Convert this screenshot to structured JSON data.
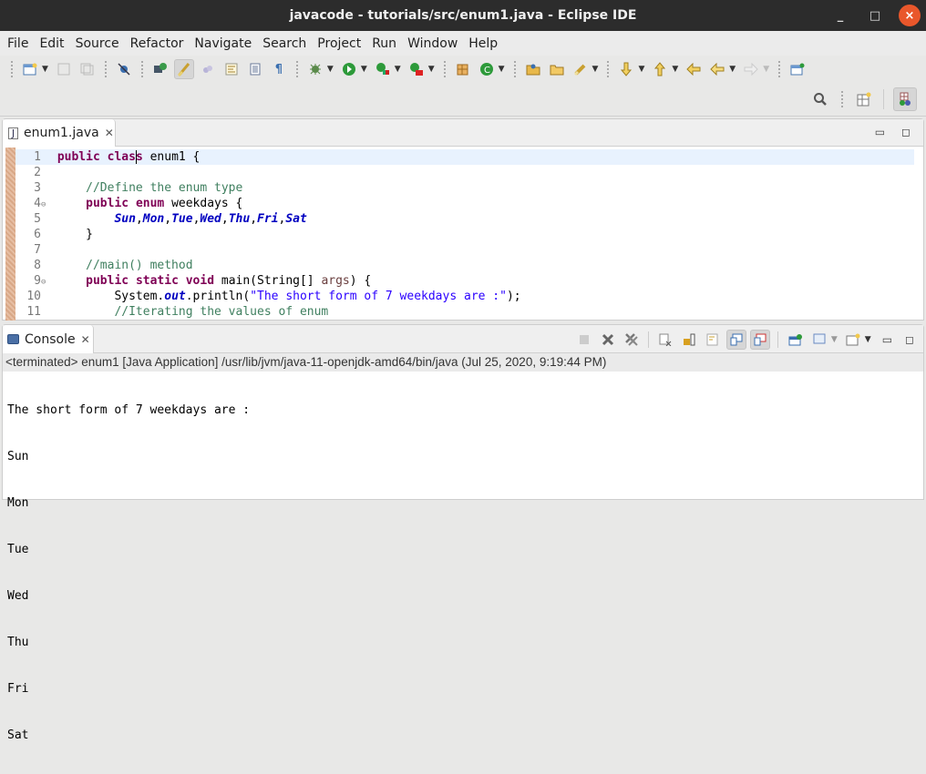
{
  "window": {
    "title": "javacode - tutorials/src/enum1.java - Eclipse IDE",
    "minimize_label": "_",
    "maximize_label": "□",
    "close_label": "×"
  },
  "menu": [
    "File",
    "Edit",
    "Source",
    "Refactor",
    "Navigate",
    "Search",
    "Project",
    "Run",
    "Window",
    "Help"
  ],
  "toolbar": {
    "icons": [
      "new-icon",
      "save-icon",
      "save-all-icon",
      "skip-breakpoints-icon",
      "open-type-icon",
      "toggle-mark-occurrences-icon",
      "toggle-block-selection-icon",
      "word-wrap-icon",
      "show-whitespace-icon",
      "debug-icon",
      "run-icon",
      "coverage-icon",
      "external-tools-icon",
      "new-java-project-icon",
      "new-class-icon",
      "open-task-icon",
      "search-icon",
      "next-annotation-icon",
      "previous-annotation-icon",
      "last-edit-icon",
      "back-icon",
      "forward-icon",
      "pin-editor-icon"
    ],
    "row2_icons": [
      "quick-access-search-icon",
      "open-perspective-icon",
      "java-perspective-icon"
    ]
  },
  "editor": {
    "tab_label": "enum1.java",
    "lines": [
      {
        "n": "1",
        "fold": ""
      },
      {
        "n": "2",
        "fold": ""
      },
      {
        "n": "3",
        "fold": ""
      },
      {
        "n": "4",
        "fold": "⊖"
      },
      {
        "n": "5",
        "fold": ""
      },
      {
        "n": "6",
        "fold": ""
      },
      {
        "n": "7",
        "fold": ""
      },
      {
        "n": "8",
        "fold": ""
      },
      {
        "n": "9",
        "fold": "⊖"
      },
      {
        "n": "10",
        "fold": ""
      },
      {
        "n": "11",
        "fold": ""
      }
    ],
    "code": {
      "l1_kw1": "public",
      "l1_kw2a": "clas",
      "l1_kw2b": "s",
      "l1_rest": " enum1 {",
      "l3_comment": "//Define the enum type",
      "l4_kw1": "public",
      "l4_kw2": "enum",
      "l4_rest": " weekdays {",
      "l5_values": [
        "Sun",
        "Mon",
        "Tue",
        "Wed",
        "Thu",
        "Fri",
        "Sat"
      ],
      "l6": "}",
      "l8_comment": "//main() method",
      "l9_kw1": "public",
      "l9_kw2": "static",
      "l9_kw3": "void",
      "l9_mid": " main(String[] ",
      "l9_arg": "args",
      "l9_end": ") {",
      "l10_a": "System.",
      "l10_field": "out",
      "l10_b": ".println(",
      "l10_str": "\"The short form of 7 weekdays are :\"",
      "l10_c": ");",
      "l11_comment": "//Iterating the values of enum"
    }
  },
  "console": {
    "tab_label": "Console",
    "status": "<terminated> enum1 [Java Application] /usr/lib/jvm/java-11-openjdk-amd64/bin/java (Jul 25, 2020, 9:19:44 PM)",
    "output": [
      "The short form of 7 weekdays are :",
      "Sun",
      "Mon",
      "Tue",
      "Wed",
      "Thu",
      "Fri",
      "Sat"
    ],
    "tool_icons": [
      "terminate-icon",
      "remove-launch-icon",
      "remove-all-terminated-icon",
      "clear-console-icon",
      "scroll-lock-icon",
      "word-wrap-icon",
      "show-on-stdout-icon",
      "show-on-stderr-icon",
      "pin-console-icon",
      "display-console-icon",
      "open-console-icon"
    ]
  }
}
